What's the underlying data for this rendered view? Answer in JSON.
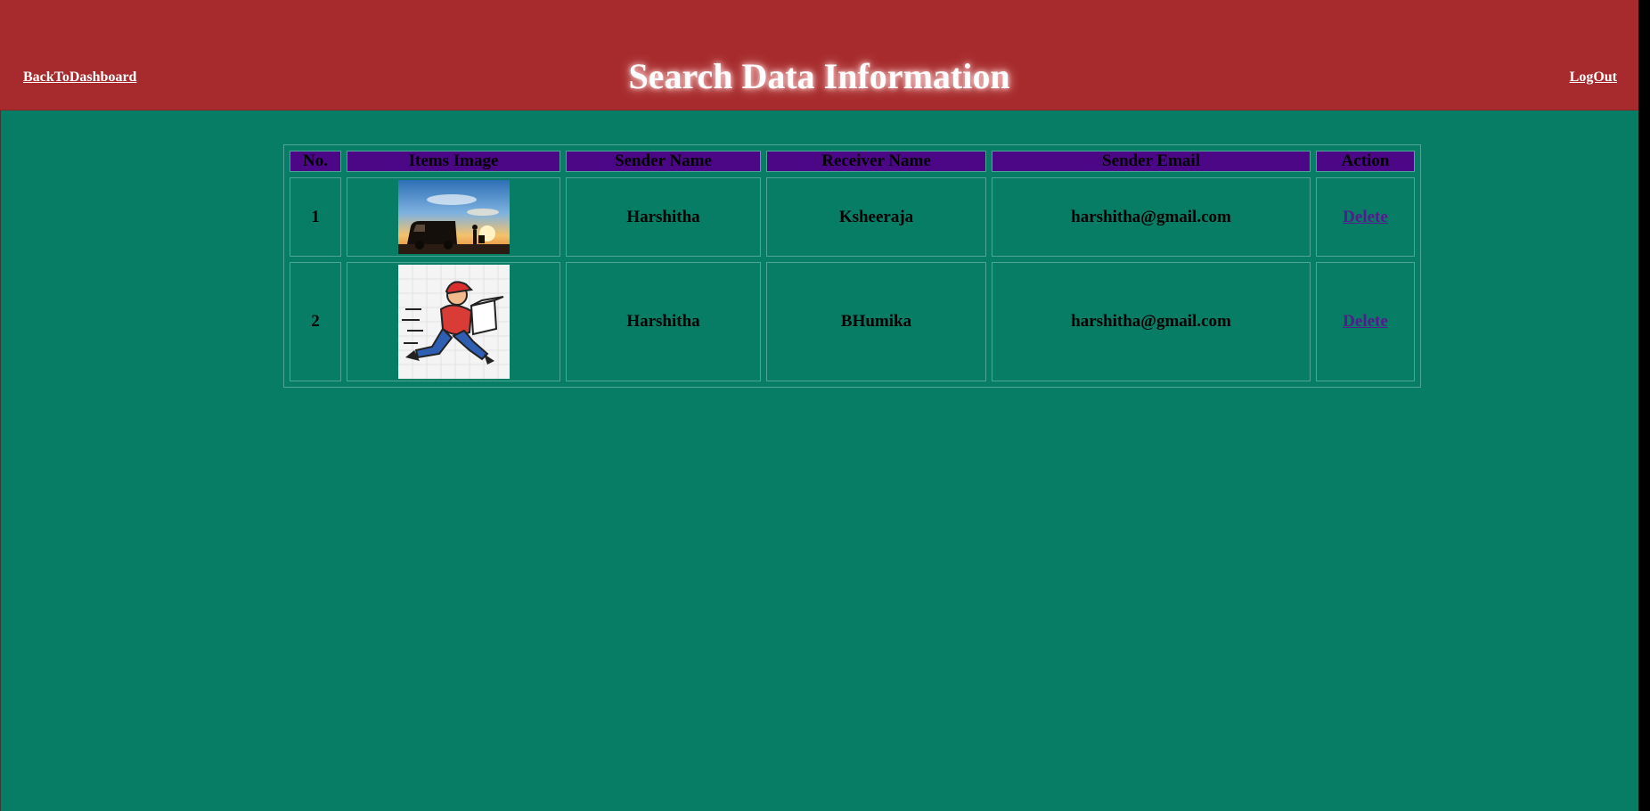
{
  "header": {
    "back_label": "BackToDashboard",
    "title": "Search Data Information",
    "logout_label": "LogOut"
  },
  "table": {
    "columns": [
      "No.",
      "Items Image",
      "Sender Name",
      "Receiver Name",
      "Sender Email",
      "Action"
    ],
    "rows": [
      {
        "no": "1",
        "image": "delivery-van-sunset-image",
        "sender_name": "Harshitha",
        "receiver_name": "Ksheeraja",
        "sender_email": "harshitha@gmail.com",
        "action": "Delete"
      },
      {
        "no": "2",
        "image": "running-courier-cartoon-image",
        "sender_name": "Harshitha",
        "receiver_name": "BHumika",
        "sender_email": "harshitha@gmail.com",
        "action": "Delete"
      }
    ]
  },
  "colors": {
    "header_bg": "#a72b2c",
    "page_bg": "#077d66",
    "table_header_bg": "#4b0786",
    "link_visited": "#551a8b"
  }
}
